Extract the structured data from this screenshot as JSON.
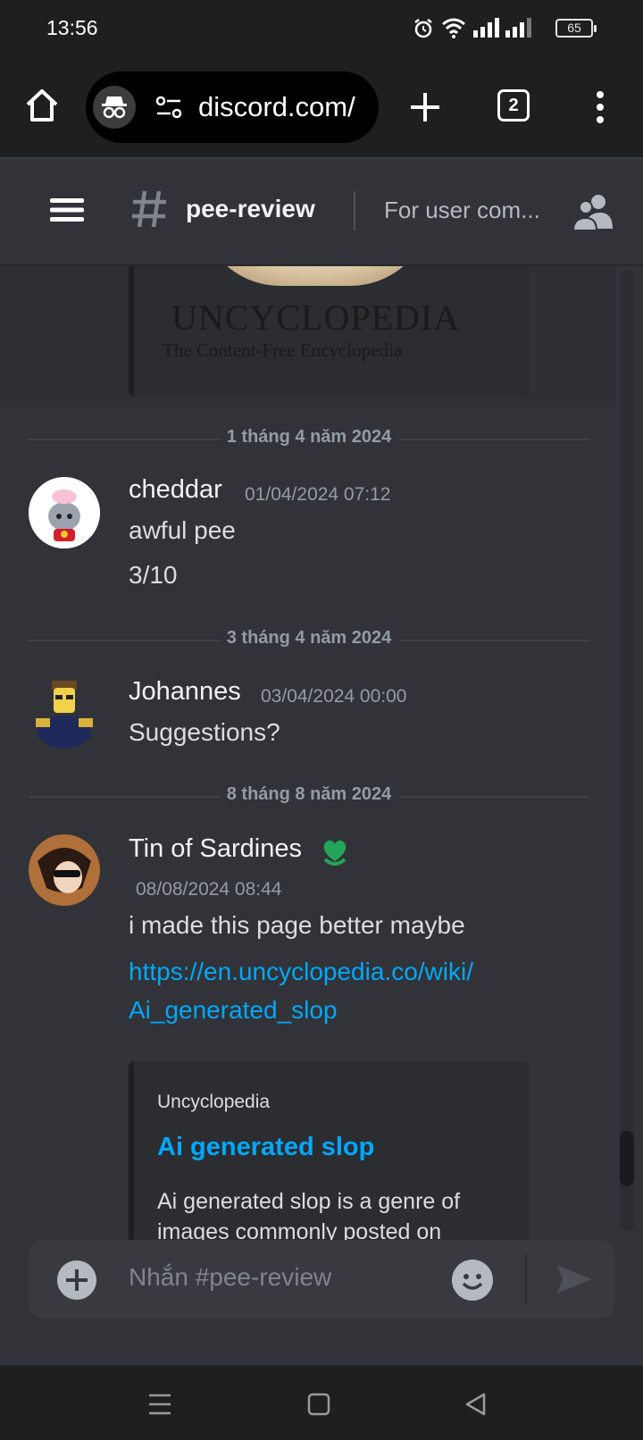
{
  "status_bar": {
    "time": "13:56",
    "battery": "65"
  },
  "browser": {
    "url": "discord.com/",
    "tab_count": "2"
  },
  "channel": {
    "name": "pee-review",
    "topic": "For user com..."
  },
  "previous_embed": {
    "logo_title": "UNCYCLOPEDIA",
    "logo_subtitle": "The Content-Free Encyclopedia"
  },
  "messages": [
    {
      "date_divider": "1 tháng 4 năm 2024",
      "author": "cheddar",
      "timestamp": "01/04/2024 07:12",
      "lines": [
        "awful pee",
        "3/10"
      ]
    },
    {
      "date_divider": "3 tháng 4 năm 2024",
      "author": "Johannes",
      "timestamp": "03/04/2024 00:00",
      "lines": [
        "Suggestions?"
      ]
    },
    {
      "date_divider": "8 tháng 8 năm 2024",
      "author": "Tin of Sardines",
      "timestamp": "08/08/2024 08:44",
      "lines": [
        "i made this page better maybe"
      ],
      "link_lines": [
        "https://en.uncyclopedia.co/wiki/",
        "Ai_generated_slop"
      ],
      "embed": {
        "provider": "Uncyclopedia",
        "title": "Ai generated slop",
        "description": "Ai generated slop is a genre of images commonly posted on"
      }
    }
  ],
  "composer": {
    "placeholder": "Nhắn #pee-review"
  },
  "colors": {
    "background": "#313338",
    "link": "#00a8fc",
    "role_icon": "#23a55a"
  }
}
